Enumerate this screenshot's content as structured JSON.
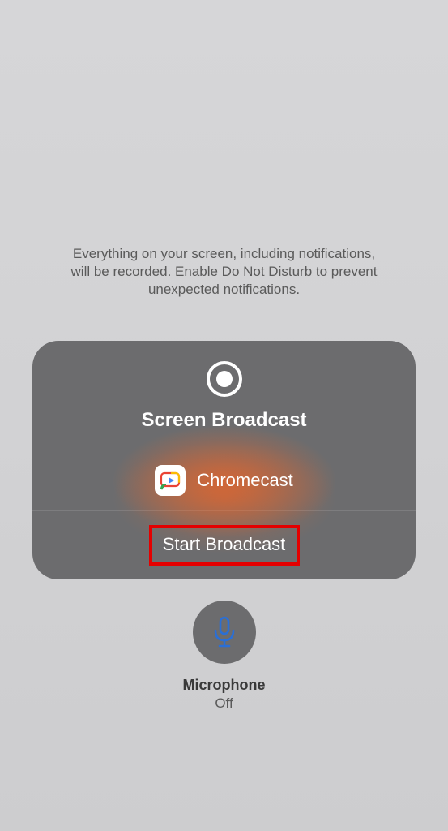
{
  "info_text": "Everything on your screen, including notifications, will be recorded. Enable Do Not Disturb to prevent unexpected notifications.",
  "panel": {
    "title": "Screen Broadcast",
    "app": {
      "label": "Chromecast",
      "icon_name": "chromecast-app-icon"
    },
    "start_button": "Start Broadcast"
  },
  "microphone": {
    "label": "Microphone",
    "status": "Off"
  }
}
